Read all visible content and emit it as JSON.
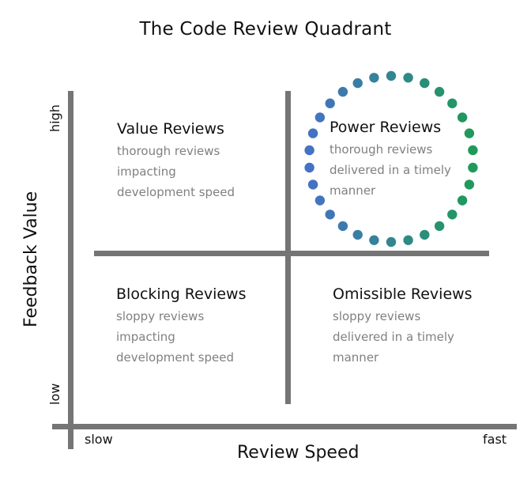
{
  "title": "The Code Review Quadrant",
  "axes": {
    "x_label": "Review Speed",
    "y_label": "Feedback Value",
    "x_low": "slow",
    "x_high": "fast",
    "y_low": "low",
    "y_high": "high"
  },
  "quadrants": {
    "top_left": {
      "title": "Value Reviews",
      "lines": [
        "thorough reviews",
        "impacting",
        "development speed"
      ]
    },
    "top_right": {
      "title": "Power Reviews",
      "lines": [
        "thorough reviews",
        "delivered in a timely",
        "manner"
      ]
    },
    "bottom_left": {
      "title": "Blocking Reviews",
      "lines": [
        "sloppy reviews",
        "impacting",
        "development speed"
      ]
    },
    "bottom_right": {
      "title": "Omissible Reviews",
      "lines": [
        "sloppy reviews",
        "delivered in a timely",
        "manner"
      ]
    }
  },
  "highlight": {
    "color_start": "#4472c4",
    "color_end": "#1f9a5a",
    "dot_count": 30
  },
  "colors": {
    "axis": "#757575",
    "subtext": "#808080"
  }
}
